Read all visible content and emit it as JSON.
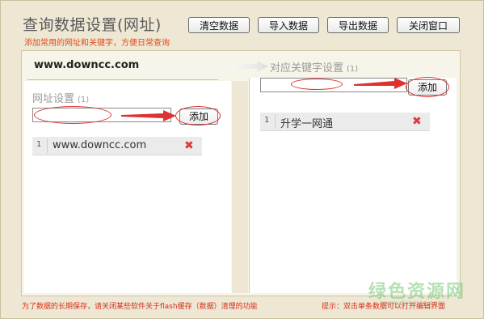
{
  "header": {
    "title": "查询数据设置(网址)",
    "subtitle": "添加常用的网址和关键字，方便日常查询"
  },
  "toolbar": {
    "clear_label": "清空数据",
    "import_label": "导入数据",
    "export_label": "导出数据",
    "close_label": "关闭窗口"
  },
  "banner": {
    "site": "www.downcc.com"
  },
  "url_section": {
    "title": "网址设置",
    "count": "(1)",
    "input_value": "",
    "add_label": "添加",
    "items": [
      {
        "index": "1",
        "value": "www.downcc.com"
      }
    ]
  },
  "keyword_section": {
    "title": "对应关键字设置",
    "count": "(1)",
    "input_value": "",
    "add_label": "添加",
    "items": [
      {
        "index": "1",
        "value": "升学一网通"
      }
    ]
  },
  "footer": {
    "note": "为了数据的长期保存，请关闭某些软件关于flash缓存（数据）清理的功能",
    "hint": "提示：双击单条数据可以打开编辑界面"
  },
  "watermark": {
    "text": "绿色资源网",
    "url": "www.downcc.com"
  },
  "icons": {
    "delete": "delete-x-icon",
    "arrow": "red-arrow-icon"
  },
  "colors": {
    "accent_red": "#e03030",
    "background": "#ede7d3"
  }
}
